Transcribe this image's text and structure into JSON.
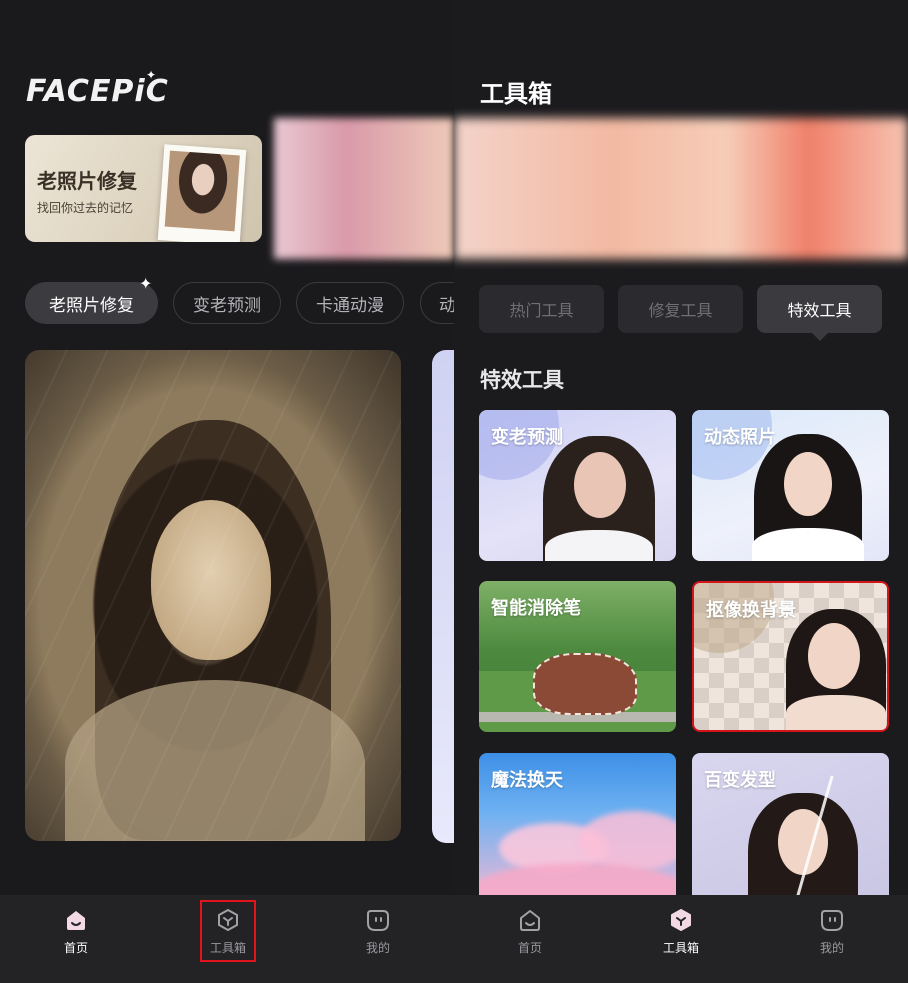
{
  "left_screen": {
    "logo": "FACEPiC",
    "banner": {
      "title": "老照片修复",
      "subtitle": "找回你过去的记忆"
    },
    "chips": [
      "老照片修复",
      "变老预测",
      "卡通动漫",
      "动"
    ],
    "bottom_nav": [
      {
        "label": "首页",
        "icon": "home-icon",
        "selected": true
      },
      {
        "label": "工具箱",
        "icon": "toolbox-icon",
        "selected": false,
        "highlighted": true
      },
      {
        "label": "我的",
        "icon": "profile-icon",
        "selected": false
      }
    ]
  },
  "right_screen": {
    "title": "工具箱",
    "categories": [
      "热门工具",
      "修复工具",
      "特效工具"
    ],
    "active_category": "特效工具",
    "section_title": "特效工具",
    "tools": [
      {
        "name": "变老预测"
      },
      {
        "name": "动态照片"
      },
      {
        "name": "智能消除笔"
      },
      {
        "name": "抠像换背景",
        "highlighted": true
      },
      {
        "name": "魔法换天"
      },
      {
        "name": "百变发型"
      }
    ],
    "bottom_nav": [
      {
        "label": "首页",
        "icon": "home-icon",
        "selected": false
      },
      {
        "label": "工具箱",
        "icon": "toolbox-icon",
        "selected": true
      },
      {
        "label": "我的",
        "icon": "profile-icon",
        "selected": false
      }
    ]
  },
  "colors": {
    "background": "#19191c",
    "highlight": "#e0141a",
    "active_chip": "#3b3b40"
  }
}
